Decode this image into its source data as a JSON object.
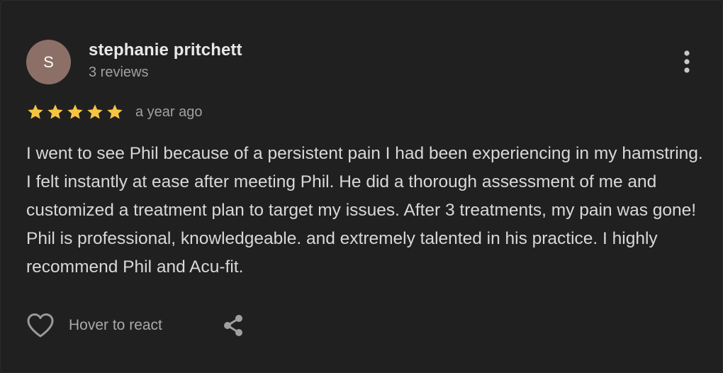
{
  "review": {
    "avatar_initial": "S",
    "reviewer_name": "stephanie pritchett",
    "reviewer_review_count": "3 reviews",
    "rating": 5,
    "rating_max": 5,
    "date": "a year ago",
    "text": "I went to see Phil because of a persistent pain I had been experiencing in my hamstring. I felt instantly at ease after meeting Phil. He did a thorough assessment of me and customized a treatment plan to target my issues. After 3 treatments, my pain was gone! Phil is professional, knowledgeable. and extremely talented in his practice. I highly recommend Phil and Acu-fit.",
    "react_label": "Hover to react"
  },
  "icons": {
    "more": "more-vert-icon",
    "star": "star-icon",
    "react": "heart-outline-icon",
    "share": "share-icon"
  },
  "colors": {
    "background": "#202020",
    "avatar": "#8c6f67",
    "star": "#f6c443",
    "text_primary": "#e8e8e8",
    "text_secondary": "#a0a0a0"
  }
}
